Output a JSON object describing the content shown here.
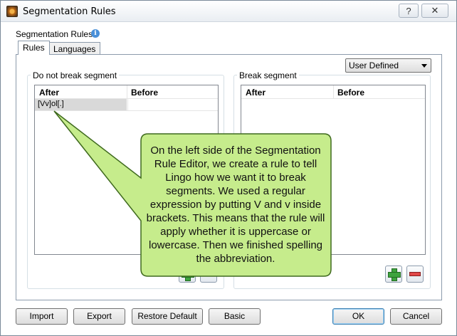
{
  "window": {
    "title": "Segmentation Rules",
    "help_label": "?",
    "close_label": "✕"
  },
  "section": {
    "label": "Segmentation Rules"
  },
  "tabs": [
    {
      "label": "Rules"
    },
    {
      "label": "Languages"
    }
  ],
  "dropdown": {
    "selected": "User Defined"
  },
  "do_not_break": {
    "title": "Do not break segment",
    "columns": [
      "After",
      "Before"
    ],
    "rows": [
      {
        "after": "[Vv]ol[.]",
        "before": ""
      }
    ]
  },
  "break": {
    "title": "Break segment",
    "columns": [
      "After",
      "Before"
    ],
    "rows": []
  },
  "buttons": {
    "import": "Import",
    "export": "Export",
    "restore_default": "Restore Default",
    "basic": "Basic",
    "ok": "OK",
    "cancel": "Cancel"
  },
  "callout": {
    "text": "On the left side of the Segmentation Rule Editor, we create a rule to tell Lingo how we want it to break segments. We used a regular expression by putting V and v inside brackets. This means that the rule will apply whether it is uppercase or lowercase. Then we finished spelling the abbreviation."
  },
  "colors": {
    "callout_fill": "#c6ec8c",
    "callout_stroke": "#3f6a1e",
    "add": "#3ea33e",
    "remove": "#e04848"
  },
  "icons": {
    "app": "app-icon",
    "info": "info-icon",
    "add": "plus-icon",
    "remove": "minus-icon"
  }
}
